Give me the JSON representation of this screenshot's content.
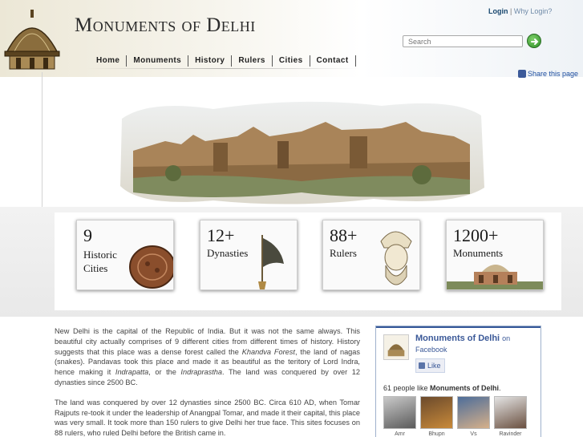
{
  "header": {
    "title": "Monuments of Delhi",
    "login_label": "Login",
    "separator": "|",
    "why_login_label": "Why Login?",
    "search_placeholder": "Search",
    "share_label": "Share this page"
  },
  "nav": {
    "items": [
      {
        "label": "Home"
      },
      {
        "label": "Monuments"
      },
      {
        "label": "History"
      },
      {
        "label": "Rulers"
      },
      {
        "label": "Cities"
      },
      {
        "label": "Contact"
      }
    ]
  },
  "stats": [
    {
      "number": "9",
      "label_line1": "Historic",
      "label_line2": "Cities"
    },
    {
      "number": "12+",
      "label_line1": "Dynasties",
      "label_line2": ""
    },
    {
      "number": "88+",
      "label_line1": "Rulers",
      "label_line2": ""
    },
    {
      "number": "1200+",
      "label_line1": "Monuments",
      "label_line2": ""
    }
  ],
  "intro": {
    "p1_a": "New Delhi is the capital of the Republic of India. But it was not the same always. This beautiful city actually comprises of 9 different cities from different times of history. History suggests that this place was a dense forest called the ",
    "p1_b": "Khandva Forest",
    "p1_c": ", the land of nagas (snakes). Pandavas took this place and made it as beautiful as the teritory of Lord Indra, hence making it ",
    "p1_d": "Indrapatta",
    "p1_e": ", or the ",
    "p1_f": "Indraprastha",
    "p1_g": ". The land was conquered by over 12 dynasties since 2500 BC.",
    "p2": "The land was conquered by over 12 dynasties since 2500 BC. Circa 610 AD, when Tomar Rajputs re-took it under the leadership of Anangpal Tomar, and made it their capital, this place was very small. It took more than 150 rulers to give Delhi her true face. This sites focuses on 88 rulers, who ruled Delhi before the British came in."
  },
  "facebook": {
    "page_name": "Monuments of Delhi",
    "on_label": "on",
    "site_label": "Facebook",
    "like_label": "Like",
    "count_prefix": "61 people like ",
    "count_page": "Monuments of Delhi",
    "count_suffix": ".",
    "faces": [
      {
        "name": "Amr"
      },
      {
        "name": "Bhupn"
      },
      {
        "name": "Vs"
      },
      {
        "name": "Ravinder"
      }
    ]
  },
  "colors": {
    "accent_blue": "#3b5998",
    "link_blue": "#17466e",
    "sandstone": "#b0895a"
  }
}
